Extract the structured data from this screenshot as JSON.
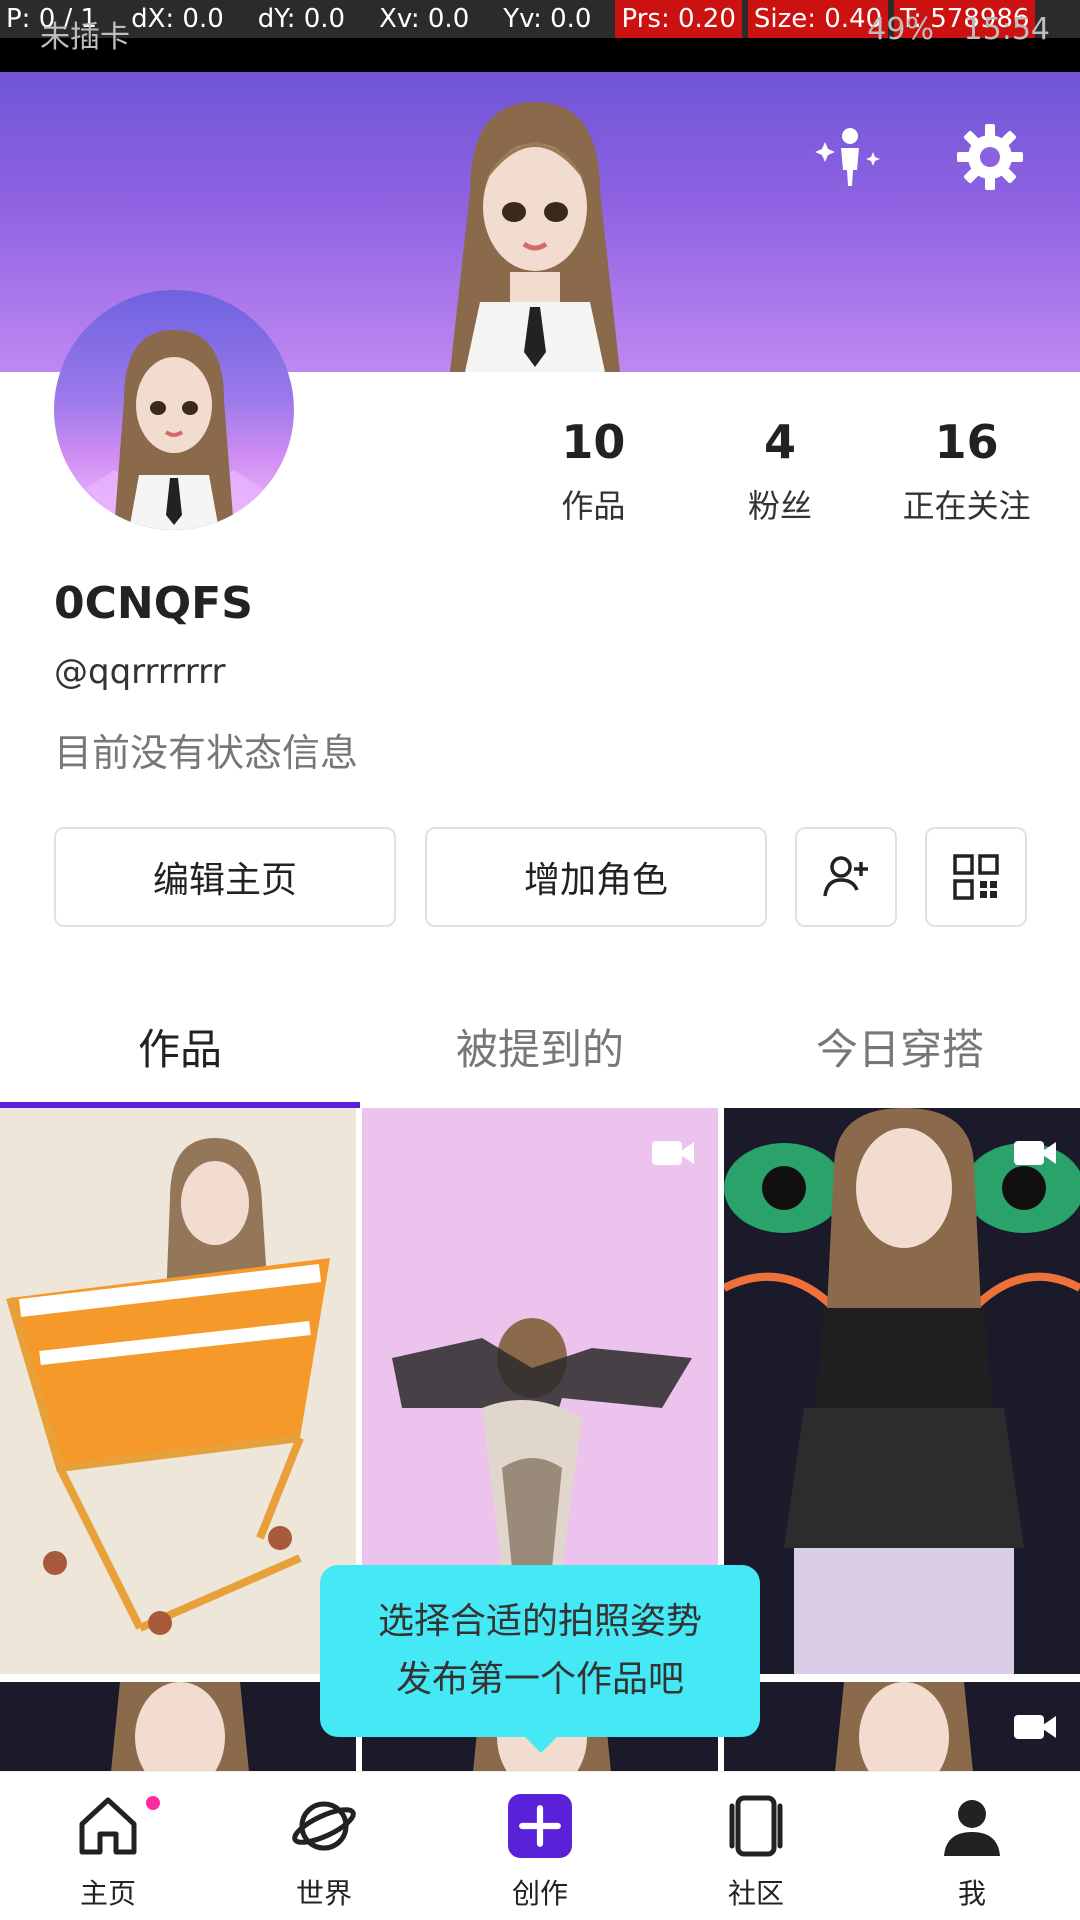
{
  "debug": {
    "p": "P: 0 / 1",
    "dx": "dX: 0.0",
    "dy": "dY: 0.0",
    "xv": "Xv: 0.0",
    "yv": "Yv: 0.0",
    "prs": "Prs: 0.20",
    "size": "Size: 0.40",
    "t": "T: 578986"
  },
  "status": {
    "carrier": "未插卡",
    "battery": "49%",
    "time": "15:54"
  },
  "profile": {
    "nickname": "0CNQFS",
    "handle": "@qqrrrrrrr",
    "status_message": "目前没有状态信息",
    "stats": [
      {
        "num": "10",
        "label": "作品"
      },
      {
        "num": "4",
        "label": "粉丝"
      },
      {
        "num": "16",
        "label": "正在关注"
      }
    ]
  },
  "actions": {
    "edit": "编辑主页",
    "add_role": "增加角色",
    "add_friend_icon": "add-user-icon",
    "qr_icon": "qr-code-icon"
  },
  "tabs": [
    {
      "label": "作品",
      "active": true
    },
    {
      "label": "被提到的",
      "active": false
    },
    {
      "label": "今日穿搭",
      "active": false
    }
  ],
  "tooltip": {
    "line1": "选择合适的拍照姿势",
    "line2": "发布第一个作品吧"
  },
  "nav": [
    {
      "label": "主页",
      "icon": "home-icon"
    },
    {
      "label": "世界",
      "icon": "planet-icon"
    },
    {
      "label": "创作",
      "icon": "create-plus-icon"
    },
    {
      "label": "社区",
      "icon": "community-icon"
    },
    {
      "label": "我",
      "icon": "person-icon"
    }
  ],
  "colors": {
    "accent": "#5a22d8",
    "banner_top": "#6f56d6",
    "banner_bottom": "#bf88f1",
    "tooltip": "#45e9f5",
    "notification_dot": "#ff2aa3"
  }
}
